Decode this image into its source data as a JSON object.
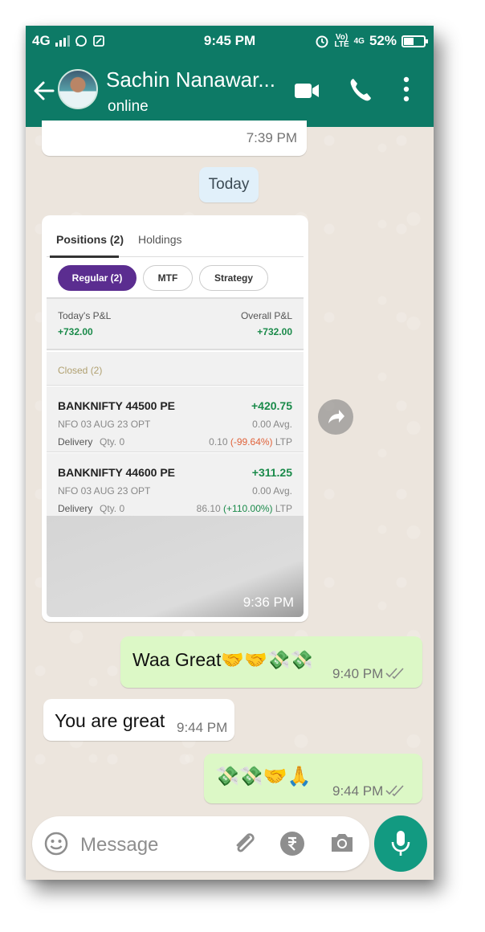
{
  "status_bar": {
    "network_left": "4G",
    "time": "9:45 PM",
    "volte_top": "Vo)",
    "volte_bottom": "LTE",
    "network_right": "4G",
    "battery": "52%",
    "battery_level": 0.52
  },
  "header": {
    "contact_name": "Sachin Nanawar...",
    "contact_status": "online"
  },
  "chat": {
    "prev_message_time": "7:39 PM",
    "date_divider": "Today",
    "image_message": {
      "time": "9:36 PM",
      "screenshot": {
        "tabs": [
          "Positions (2)",
          "Holdings"
        ],
        "filters": [
          "Regular (2)",
          "MTF",
          "Strategy"
        ],
        "todays_pnl_label": "Today's P&L",
        "todays_pnl_value": "+732.00",
        "overall_pnl_label": "Overall P&L",
        "overall_pnl_value": "+732.00",
        "closed_label": "Closed (2)",
        "positions": [
          {
            "symbol": "BANKNIFTY 44500 PE",
            "pnl": "+420.75",
            "expiry": "NFO 03 AUG 23 OPT",
            "avg": "0.00 Avg.",
            "product": "Delivery",
            "qty": "Qty. 0",
            "ltp_price": "0.10",
            "ltp_change": "(-99.64%)",
            "ltp_label": "LTP"
          },
          {
            "symbol": "BANKNIFTY 44600 PE",
            "pnl": "+311.25",
            "expiry": "NFO 03 AUG 23 OPT",
            "avg": "0.00 Avg.",
            "product": "Delivery",
            "qty": "Qty. 0",
            "ltp_price": "86.10",
            "ltp_change": "(+110.00%)",
            "ltp_label": "LTP"
          }
        ]
      }
    },
    "messages": [
      {
        "direction": "out",
        "text": "Waa Great🤝🤝💸💸",
        "time": "9:40 PM"
      },
      {
        "direction": "in",
        "text": "You are great",
        "time": "9:44 PM"
      },
      {
        "direction": "out",
        "text": "💸💸🤝🙏",
        "time": "9:44 PM"
      }
    ]
  },
  "input": {
    "placeholder": "Message"
  },
  "colors": {
    "header": "#0d7a66",
    "outgoing_bubble": "#dcf8c6",
    "incoming_bubble": "#ffffff",
    "chat_background": "#ece5dd",
    "mic_button": "#129a81",
    "positive": "#1a8a4a",
    "negative": "#e0623a",
    "active_filter": "#5b2d90"
  }
}
